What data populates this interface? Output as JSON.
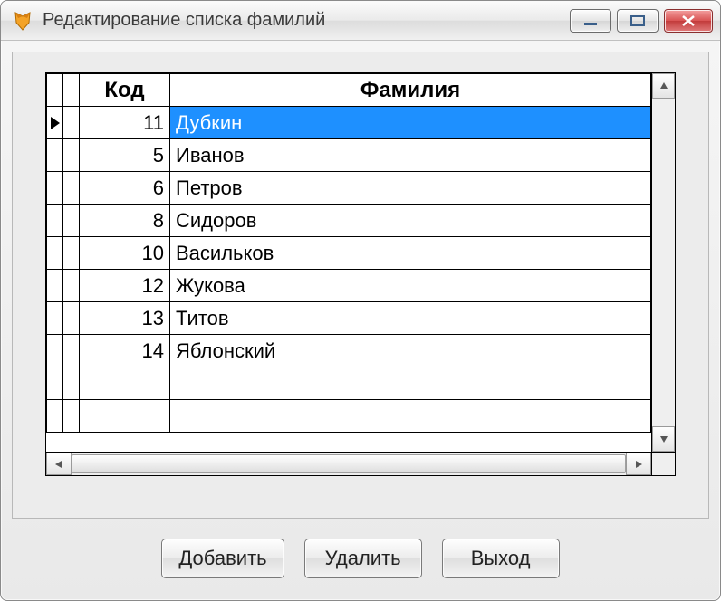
{
  "window": {
    "title": "Редактирование списка фамилий"
  },
  "grid": {
    "columns": {
      "code": "Код",
      "name": "Фамилия"
    },
    "rows": [
      {
        "code": "11",
        "name": "Дубкин",
        "selected": true
      },
      {
        "code": "5",
        "name": "Иванов",
        "selected": false
      },
      {
        "code": "6",
        "name": "Петров",
        "selected": false
      },
      {
        "code": "8",
        "name": "Сидоров",
        "selected": false
      },
      {
        "code": "10",
        "name": "Васильков",
        "selected": false
      },
      {
        "code": "12",
        "name": "Жукова",
        "selected": false
      },
      {
        "code": "13",
        "name": "Титов",
        "selected": false
      },
      {
        "code": "14",
        "name": "Яблонский",
        "selected": false
      }
    ],
    "emptyRows": 2
  },
  "buttons": {
    "add": "Добавить",
    "delete": "Удалить",
    "exit": "Выход"
  }
}
